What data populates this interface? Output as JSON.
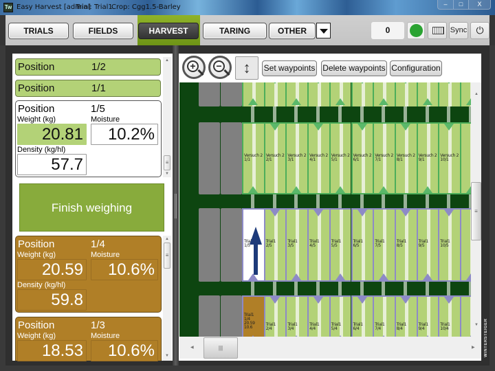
{
  "window": {
    "app_title": "Easy Harvest [admin]",
    "trial": "Trial: Trial1",
    "crop": "Crop: Cgg1.5-Barley",
    "minimize": "–",
    "maximize": "□",
    "close": "X"
  },
  "nav": {
    "tabs": [
      {
        "label": "TRIALS",
        "active": false
      },
      {
        "label": "FIELDS",
        "active": false
      },
      {
        "label": "HARVEST",
        "active": true
      },
      {
        "label": "TARING",
        "active": false
      },
      {
        "label": "OTHER",
        "active": false
      }
    ],
    "counter": "0",
    "status_color": "#2aa332",
    "sync_label": "Sync",
    "power_icon": "⏻",
    "accent_color": "#7ea11f"
  },
  "positions": {
    "collapsed": [
      {
        "label": "Position",
        "value": "1/2"
      },
      {
        "label": "Position",
        "value": "1/1"
      }
    ],
    "current": {
      "label": "Position",
      "value": "1/5",
      "weight_label": "Weight (kg)",
      "weight": "20.81",
      "moisture_label": "Moisture",
      "moisture": "10.2%",
      "density_label": "Density (kg/hl)",
      "density": "57.7"
    },
    "finish_label": "Finish weighing",
    "completed": [
      {
        "label": "Position",
        "value": "1/4",
        "weight_label": "Weight (kg)",
        "weight": "20.59",
        "moisture_label": "Moisture",
        "moisture": "10.6%",
        "density_label": "Density (kg/hl)",
        "density": "59.8"
      },
      {
        "label": "Position",
        "value": "1/3",
        "weight_label": "Weight (kg)",
        "weight": "18.53",
        "moisture_label": "Moisture",
        "moisture": "10.6%"
      }
    ]
  },
  "map_toolbar": {
    "zoom_in": "+",
    "zoom_out": "−",
    "fit": "↕",
    "set_waypoints": "Set waypoints",
    "delete_waypoints": "Delete waypoints",
    "configuration": "Configuration"
  },
  "map": {
    "rows": [
      {
        "trial": "Versuch 2",
        "rep": "1",
        "plots": [
          "1/1",
          "2/1",
          "3/1",
          "4/1",
          "5/1",
          "6/1",
          "7/1",
          "8/1",
          "9/1",
          "10/1"
        ],
        "direction": "up"
      },
      {
        "trial": "Trial1",
        "rep": "5",
        "plots": [
          "1/5",
          "2/5",
          "3/5",
          "4/5",
          "5/5",
          "6/5",
          "7/5",
          "8/5",
          "9/5",
          "10/5"
        ],
        "current": "1/5"
      },
      {
        "trial": "Trial1",
        "rep": "4",
        "plots": [
          "1/4",
          "2/4",
          "3/4",
          "4/4",
          "5/4",
          "6/4",
          "7/4",
          "8/4",
          "9/4",
          "10/4"
        ],
        "harvested": {
          "plot": "1/4",
          "weight": "20.59",
          "moisture": "10.6"
        }
      }
    ],
    "colors": {
      "field": "#0d4510",
      "plot": "#b3d277",
      "versuch_border": "#4cae5a",
      "trial_border": "#8d8ac7",
      "current_plot": "#ffffff",
      "harvested_plot": "#b07f27",
      "arrow": "#1d3a7a"
    }
  },
  "brand": "WINTERSTEIGER"
}
